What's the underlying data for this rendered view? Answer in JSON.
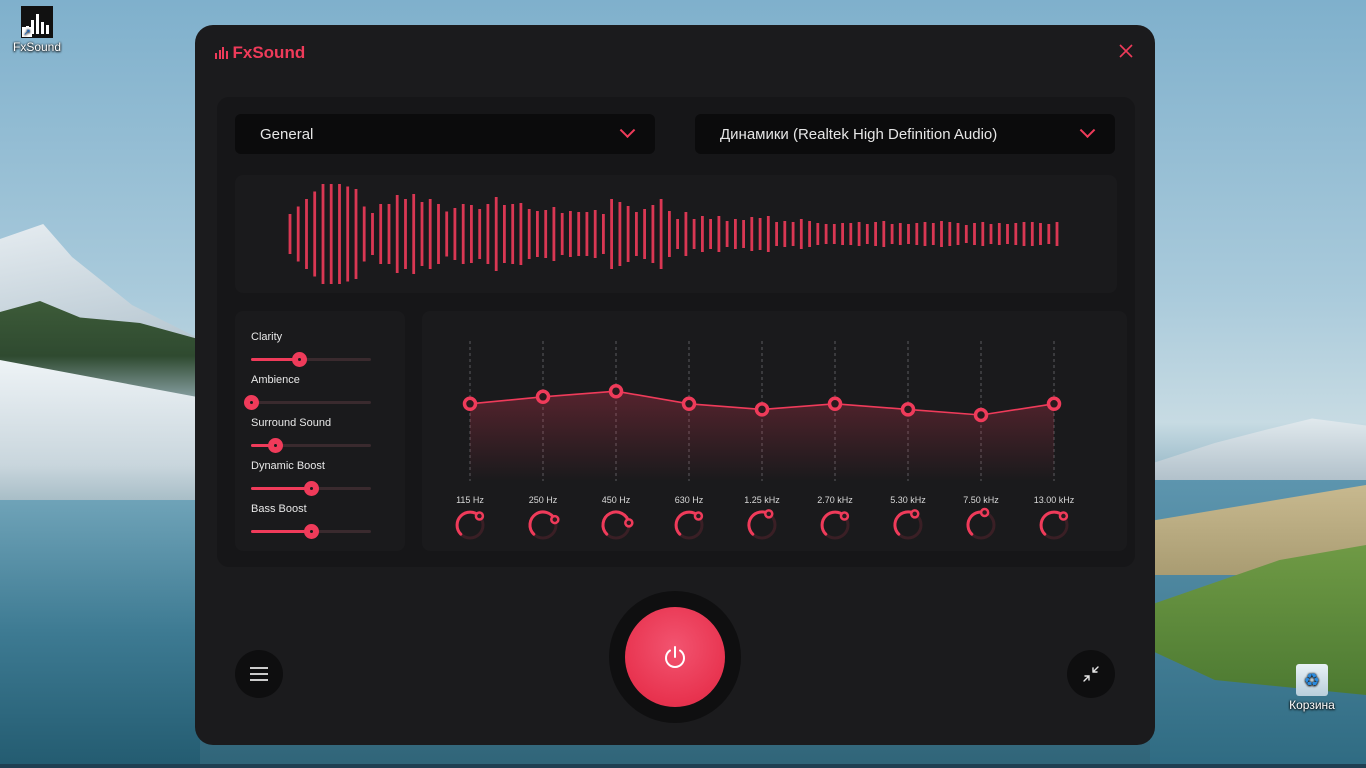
{
  "desktop": {
    "icons": [
      {
        "label": "FxSound",
        "icon": "fxsound-app-icon"
      },
      {
        "label": "Корзина",
        "icon": "recycle-bin-icon"
      }
    ]
  },
  "app": {
    "title": "FxSound",
    "accent_color": "#ef3b5a",
    "preset": {
      "selected": "General"
    },
    "output_device": {
      "selected": "Динамики (Realtek High Definition Audio)"
    },
    "effects": [
      {
        "label": "Clarity",
        "value": 0.4
      },
      {
        "label": "Ambience",
        "value": 0.0
      },
      {
        "label": "Surround Sound",
        "value": 0.2
      },
      {
        "label": "Dynamic Boost",
        "value": 0.5
      },
      {
        "label": "Bass Boost",
        "value": 0.5
      }
    ],
    "eq": {
      "bands": [
        {
          "freq": "115 Hz",
          "level": 0.48
        },
        {
          "freq": "250 Hz",
          "level": 0.53
        },
        {
          "freq": "450 Hz",
          "level": 0.57
        },
        {
          "freq": "630 Hz",
          "level": 0.48
        },
        {
          "freq": "1.25 kHz",
          "level": 0.44
        },
        {
          "freq": "2.70 kHz",
          "level": 0.48
        },
        {
          "freq": "5.30 kHz",
          "level": 0.44
        },
        {
          "freq": "7.50 kHz",
          "level": 0.4
        },
        {
          "freq": "13.00 kHz",
          "level": 0.48
        }
      ]
    },
    "waveform_levels": [
      0.4,
      0.55,
      0.7,
      0.85,
      1.0,
      1.0,
      1.0,
      0.95,
      0.9,
      0.55,
      0.42,
      0.6,
      0.6,
      0.78,
      0.7,
      0.8,
      0.64,
      0.7,
      0.6,
      0.45,
      0.52,
      0.6,
      0.58,
      0.5,
      0.6,
      0.74,
      0.58,
      0.6,
      0.62,
      0.5,
      0.46,
      0.48,
      0.54,
      0.42,
      0.46,
      0.44,
      0.44,
      0.48,
      0.4,
      0.7,
      0.64,
      0.56,
      0.44,
      0.5,
      0.58,
      0.7,
      0.46,
      0.3,
      0.44,
      0.3,
      0.36,
      0.3,
      0.36,
      0.26,
      0.3,
      0.28,
      0.34,
      0.32,
      0.36,
      0.24,
      0.26,
      0.24,
      0.3,
      0.26,
      0.22,
      0.2,
      0.2,
      0.22,
      0.22,
      0.24,
      0.2,
      0.24,
      0.26,
      0.2,
      0.22,
      0.2,
      0.22,
      0.24,
      0.22,
      0.26,
      0.24,
      0.22,
      0.18,
      0.22,
      0.24,
      0.2,
      0.22,
      0.2,
      0.22,
      0.24,
      0.24,
      0.22,
      0.2,
      0.24
    ],
    "buttons": {
      "menu": "hamburger-menu-icon",
      "power": "power-icon",
      "minimize": "compact-view-icon",
      "close": "close-icon"
    }
  }
}
